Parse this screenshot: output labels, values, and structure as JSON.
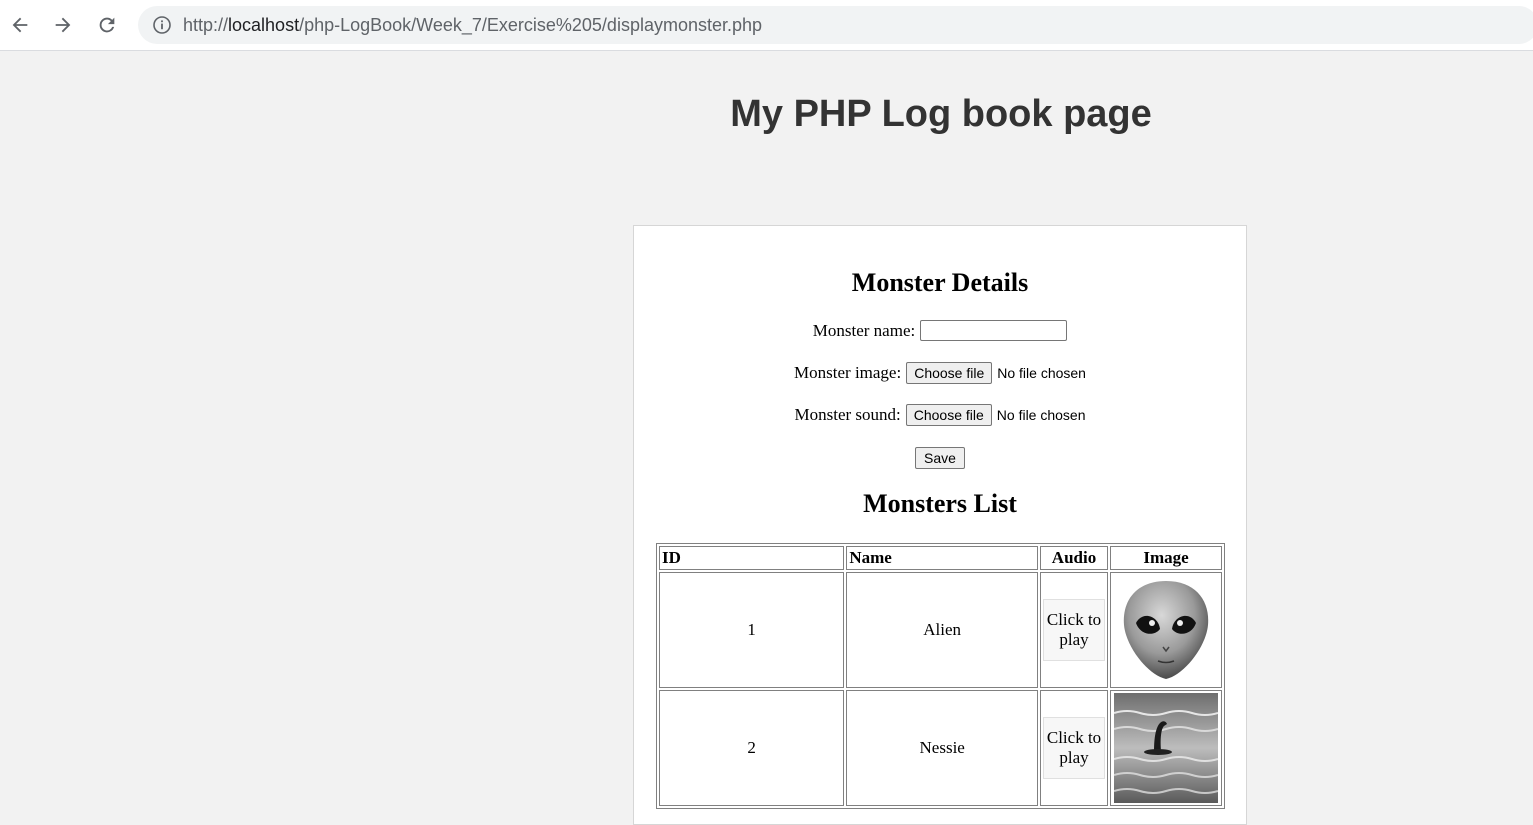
{
  "browser": {
    "url_scheme": "http://",
    "url_host": "localhost",
    "url_path": "/php-LogBook/Week_7/Exercise%205/displaymonster.php",
    "back_icon": "arrow-left-icon",
    "forward_icon": "arrow-right-icon",
    "reload_icon": "reload-icon",
    "info_icon": "info-circle-icon"
  },
  "page": {
    "title": "My PHP Log book page"
  },
  "form": {
    "heading": "Monster Details",
    "name_label": "Monster name:",
    "name_value": "",
    "image_label": "Monster image:",
    "image_button": "Choose file",
    "image_status": "No file chosen",
    "sound_label": "Monster sound:",
    "sound_button": "Choose file",
    "sound_status": "No file chosen",
    "save_label": "Save"
  },
  "list": {
    "heading": "Monsters List",
    "columns": [
      "ID",
      "Name",
      "Audio",
      "Image"
    ],
    "rows": [
      {
        "id": "1",
        "name": "Alien",
        "audio": "Click to play",
        "image": "alien-head-image"
      },
      {
        "id": "2",
        "name": "Nessie",
        "audio": "Click to play",
        "image": "loch-ness-monster-image"
      }
    ]
  },
  "colors": {
    "page_bg": "#f2f2f2",
    "title_color": "#333333",
    "panel_bg": "#ffffff"
  }
}
